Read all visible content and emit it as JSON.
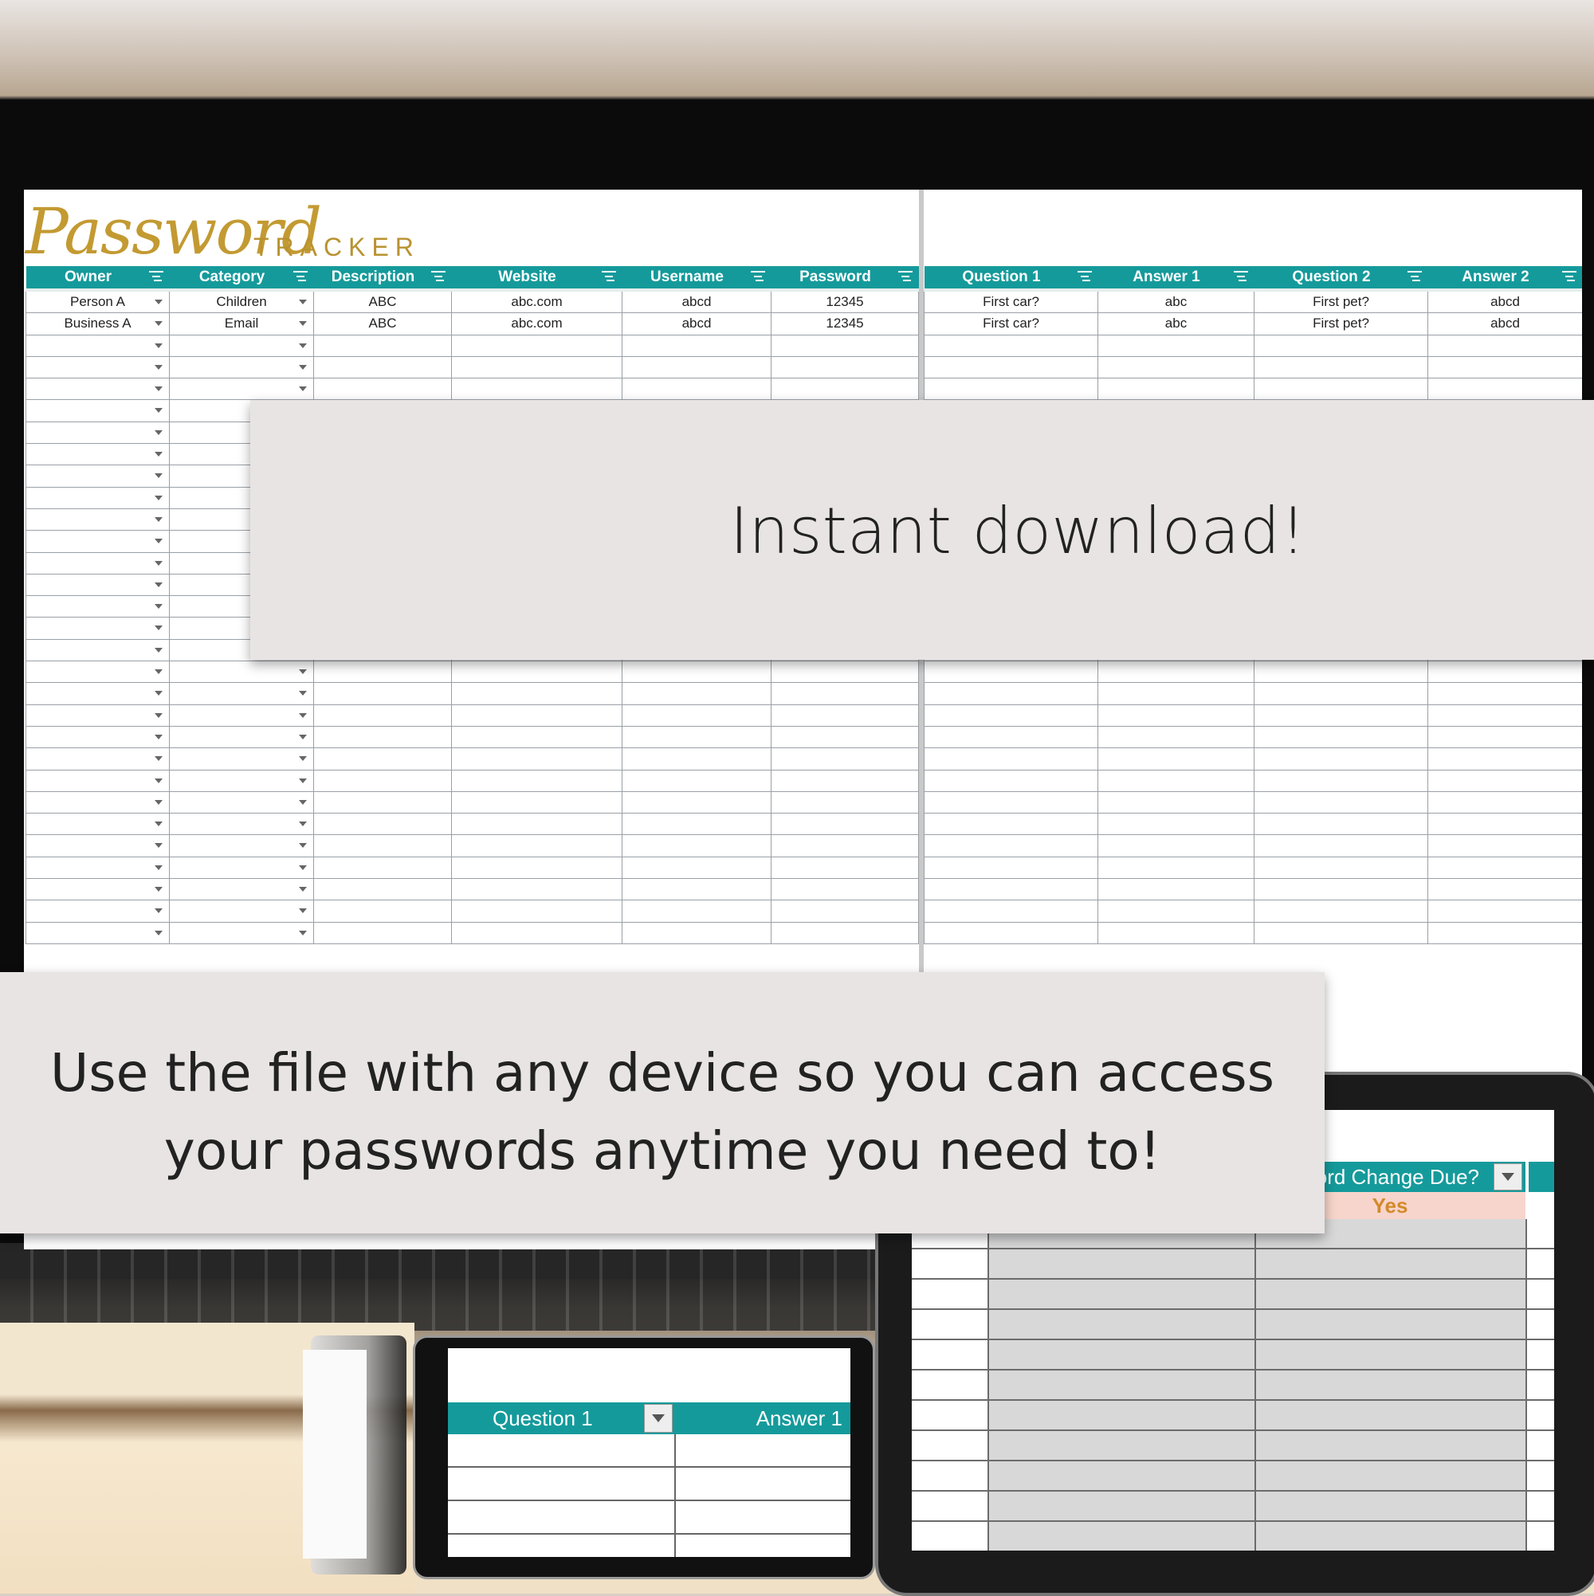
{
  "spreadsheet": {
    "title_script": "Password",
    "title_caps": "TRACKER",
    "left_columns": [
      "Owner",
      "Category",
      "Description",
      "Website",
      "Username",
      "Password"
    ],
    "right_columns": [
      "Question 1",
      "Answer 1",
      "Question 2",
      "Answer 2"
    ],
    "rows": [
      {
        "owner": "Person A",
        "category": "Children",
        "description": "ABC",
        "website": "abc.com",
        "username": "abcd",
        "password": "12345",
        "q1": "First car?",
        "a1": "abc",
        "q2": "First pet?",
        "a2": "abcd"
      },
      {
        "owner": "Business A",
        "category": "Email",
        "description": "ABC",
        "website": "abc.com",
        "username": "abcd",
        "password": "12345",
        "q1": "First car?",
        "a1": "abc",
        "q2": "First pet?",
        "a2": "abcd"
      }
    ]
  },
  "overlays": {
    "instant": "Instant download!",
    "device_line1": "Use the file with any device so you can access",
    "device_line2": "your passwords anytime you need to!"
  },
  "tablet": {
    "header": "word Change Due?",
    "value": "Yes"
  },
  "phone": {
    "col1": "Question 1",
    "col2": "Answer 1"
  },
  "colors": {
    "header_teal": "#159a9b",
    "title_gold": "#c39a32",
    "overlay_bg": "#e8e4e3"
  }
}
